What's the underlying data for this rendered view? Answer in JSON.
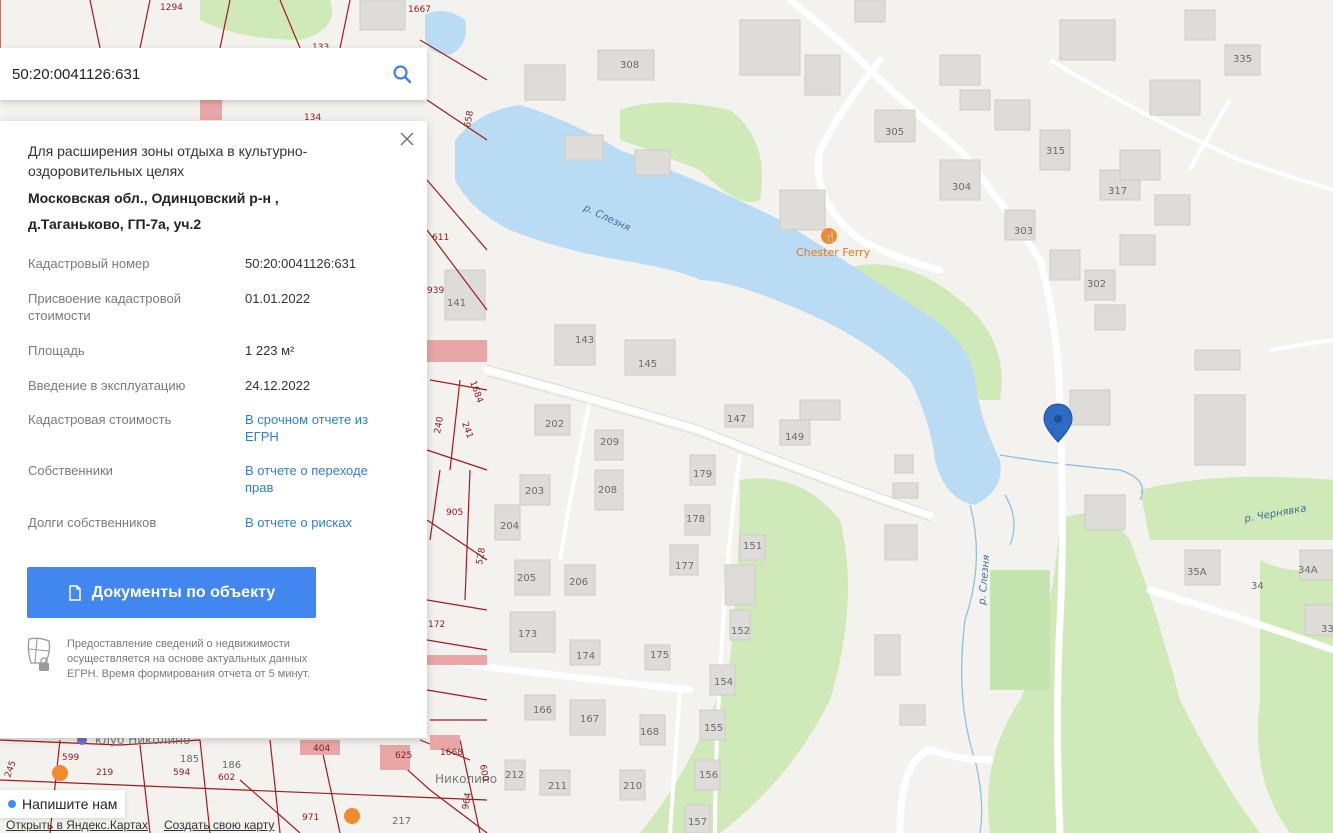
{
  "search": {
    "value": "50:20:0041126:631"
  },
  "panel": {
    "purpose": "Для расширения зоны отдыха в культурно-оздоровительных целях",
    "address": "Московская обл., Одинцовский р-н , д.Таганьково, ГП-7а, уч.2",
    "rows": [
      {
        "key": "Кадастровый номер",
        "value": "50:20:0041126:631",
        "link": false
      },
      {
        "key": "Присвоение кадастровой стоимости",
        "value": "01.01.2022",
        "link": false
      },
      {
        "key": "Площадь",
        "value": "1 223 м²",
        "link": false
      },
      {
        "key": "Введение в эксплуатацию",
        "value": "24.12.2022",
        "link": false
      },
      {
        "key": "Кадастровая стоимость",
        "value": "В срочном отчете из ЕГРН",
        "link": true
      },
      {
        "key": "Собственники",
        "value": "В отчете о переходе прав",
        "link": true
      },
      {
        "key": "Долги собственников",
        "value": "В отчете о рисках",
        "link": true
      }
    ],
    "docs_button": "Документы по объекту",
    "note": "Предоставление сведений о недвижимости осуществляется на основе актуальных данных ЕГРН. Время формирования отчета от 5 минут."
  },
  "chat": {
    "label": "Напишите нам"
  },
  "bottom_links": {
    "open": "Открыть в Яндекс.Картах",
    "create": "Создать свою карту"
  },
  "map": {
    "river_names": [
      "р. Слезня",
      "р. Слезня",
      "р. Чернявка"
    ],
    "poi": "Chester Ferry",
    "place": "Николино",
    "place_club": "клуб Николино",
    "house_numbers": [
      "308",
      "305",
      "315",
      "304",
      "317",
      "303",
      "302",
      "335",
      "141",
      "143",
      "145",
      "202",
      "209",
      "147",
      "149",
      "203",
      "208",
      "179",
      "204",
      "178",
      "205",
      "206",
      "177",
      "151",
      "173",
      "174",
      "175",
      "152",
      "154",
      "166",
      "167",
      "168",
      "155",
      "212",
      "211",
      "210",
      "156",
      "157",
      "35А",
      "34",
      "34А",
      "33",
      "185",
      "186",
      "594",
      "602",
      "404",
      "625",
      "217",
      "599",
      "219"
    ],
    "cadastral_numbers": [
      "1294",
      "1667",
      "133",
      "134",
      "658",
      "611",
      "939",
      "1684",
      "240",
      "241",
      "905",
      "528",
      "172",
      "1668",
      "600",
      "964",
      "971",
      "245"
    ],
    "colors": {
      "water": "#b9dcf4",
      "park": "#cfeab8",
      "building": "#dedcd8",
      "road": "#ffffff",
      "cadastral": "#a01c1c",
      "marker": "#2d6bc4",
      "accent": "#4286f0"
    }
  }
}
